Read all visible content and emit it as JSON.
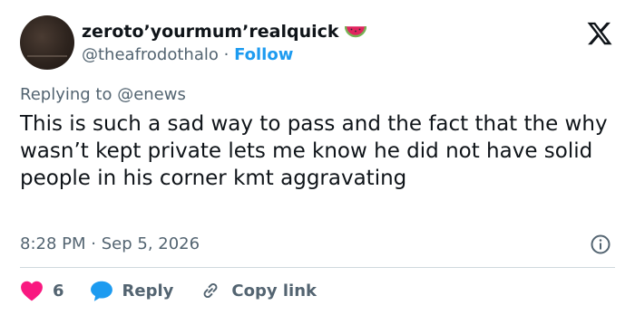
{
  "author": {
    "display_name": "zeroto’yourmum’realquick",
    "handle": "@theafrodothalo",
    "separator": "·",
    "follow_label": "Follow",
    "emoji": "watermelon-icon"
  },
  "reply_context": {
    "prefix": "Replying to ",
    "mention": "@enews"
  },
  "tweet": {
    "text": "This is such a sad way to pass and the fact that the why wasn’t kept private lets me know he did not have solid people in his corner kmt aggravating",
    "time": "8:28 PM",
    "date_separator": "·",
    "date": "Sep 5, 2026"
  },
  "actions": {
    "likes_count": "6",
    "reply_label": "Reply",
    "copy_link_label": "Copy link"
  },
  "colors": {
    "accent": "#1d9bf0",
    "heart": "#f91880",
    "secondary_text": "#536471",
    "divider": "#cfd9de"
  },
  "icons": [
    "x-logo-icon",
    "info-icon",
    "heart-icon",
    "reply-bubble-icon",
    "link-icon",
    "watermelon-icon"
  ]
}
